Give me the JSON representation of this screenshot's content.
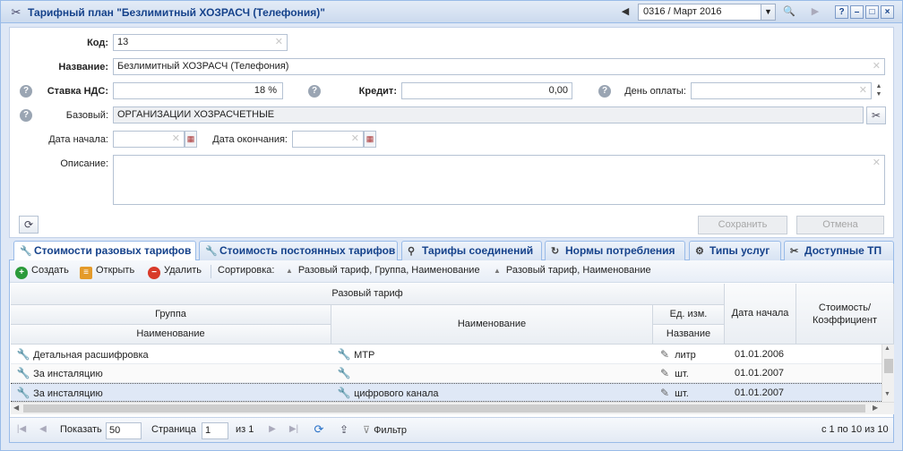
{
  "window": {
    "title": "Тарифный план \"Безлимитный ХОЗРАСЧ (Телефония)\"",
    "period": "0316 / Март 2016"
  },
  "form": {
    "code_label": "Код:",
    "code_value": "13",
    "name_label": "Название:",
    "name_value": "Безлимитный ХОЗРАСЧ (Телефония)",
    "vat_label": "Ставка НДС:",
    "vat_value": "18 %",
    "credit_label": "Кредит:",
    "credit_value": "0,00",
    "payday_label": "День оплаты:",
    "payday_value": "",
    "base_label": "Базовый:",
    "base_value": "ОРГАНИЗАЦИИ ХОЗРАСЧЕТНЫЕ",
    "start_label": "Дата начала:",
    "end_label": "Дата окончания:",
    "desc_label": "Описание:",
    "save_label": "Сохранить",
    "cancel_label": "Отмена"
  },
  "tabs": [
    {
      "label": "Стоимости разовых тарифов",
      "icon": "wrench-icon"
    },
    {
      "label": "Стоимость постоянных тарифов",
      "icon": "wrench-icon"
    },
    {
      "label": "Тарифы соединений",
      "icon": "connection-icon"
    },
    {
      "label": "Нормы потребления",
      "icon": "consumption-icon"
    },
    {
      "label": "Типы услуг",
      "icon": "services-icon"
    },
    {
      "label": "Доступные ТП",
      "icon": "tools-icon"
    }
  ],
  "toolbar": {
    "create": "Создать",
    "open": "Открыть",
    "delete": "Удалить",
    "sort_label": "Сортировка:",
    "sort1": "Разовый тариф, Группа, Наименование",
    "sort2": "Разовый тариф, Наименование"
  },
  "grid": {
    "h_tariff": "Разовый тариф",
    "h_group": "Группа",
    "h_group_name": "Наименование",
    "h_name": "Наименование",
    "h_unit": "Ед. изм.",
    "h_unit_name": "Название",
    "h_start": "Дата начала",
    "h_cost": "Стоимость/ Коэффициент",
    "rows": [
      {
        "group": "Детальная расшифровка",
        "name": "МТР",
        "unit": "литр",
        "start": "01.01.2006",
        "cost": ""
      },
      {
        "group": "За инсталяцию",
        "name": "",
        "unit": "шт.",
        "start": "01.01.2007",
        "cost": ""
      },
      {
        "group": "За инсталяцию",
        "name": "цифрового канала",
        "unit": "шт.",
        "start": "01.01.2007",
        "cost": ""
      }
    ]
  },
  "pager": {
    "show_label": "Показать",
    "page_size": "50",
    "page_label": "Страница",
    "page": "1",
    "of": "из 1",
    "filter": "Фильтр",
    "range": "с 1 по 10 из 10"
  },
  "colors": {
    "accent": "#15428b",
    "border": "#99bbe8",
    "selected_row": "#dfe8f6"
  }
}
